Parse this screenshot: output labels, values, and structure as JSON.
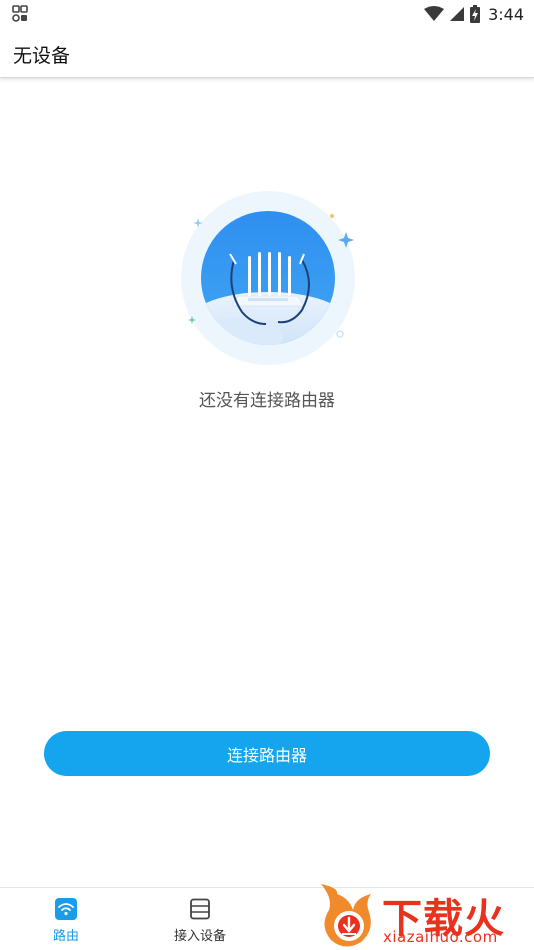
{
  "status_bar": {
    "time": "3:44",
    "left_icon": "notification-app-icon",
    "right_icons": [
      "wifi-icon",
      "cellular-signal-icon",
      "battery-charging-icon"
    ]
  },
  "app_bar": {
    "title": "无设备"
  },
  "empty_state": {
    "illustration": "router-illustration-icon",
    "message": "还没有连接路由器"
  },
  "primary_action": {
    "label": "连接路由器"
  },
  "bottom_nav": {
    "items": [
      {
        "label": "路由",
        "icon": "wifi-icon",
        "active": true
      },
      {
        "label": "接入设备",
        "icon": "device-list-icon",
        "active": false
      }
    ]
  },
  "watermark": {
    "brand": "下载火",
    "url": "xiazaihuo.com"
  },
  "colors": {
    "accent": "#15a4ee",
    "watermark": "#e8321e"
  }
}
